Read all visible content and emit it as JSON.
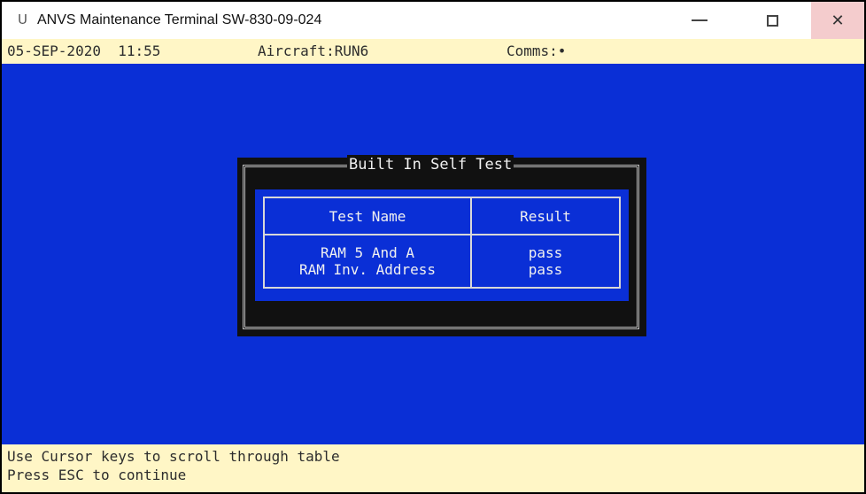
{
  "window": {
    "app_icon_glyph": "U",
    "title": "ANVS Maintenance Terminal SW-830-09-024",
    "minimize_icon": "minimize-icon",
    "maximize_icon": "maximize-icon",
    "close_glyph": "✕"
  },
  "statusbar": {
    "date_time": "05-SEP-2020  11:55",
    "aircraft": "Aircraft:RUN6",
    "comms": "Comms:•"
  },
  "dialog": {
    "title": "Built In Self Test",
    "columns": [
      "Test Name",
      "Result"
    ],
    "rows": [
      {
        "name": "RAM 5 And A",
        "result": "pass"
      },
      {
        "name": "RAM Inv. Address",
        "result": "pass"
      }
    ]
  },
  "footer": {
    "line1": "Use Cursor keys to scroll through table",
    "line2": "Press ESC to continue"
  },
  "colors": {
    "screen_blue": "#0a2fd6",
    "status_yellow": "#fff6c6",
    "dialog_black": "#111111",
    "close_hover": "#f4cccd"
  }
}
